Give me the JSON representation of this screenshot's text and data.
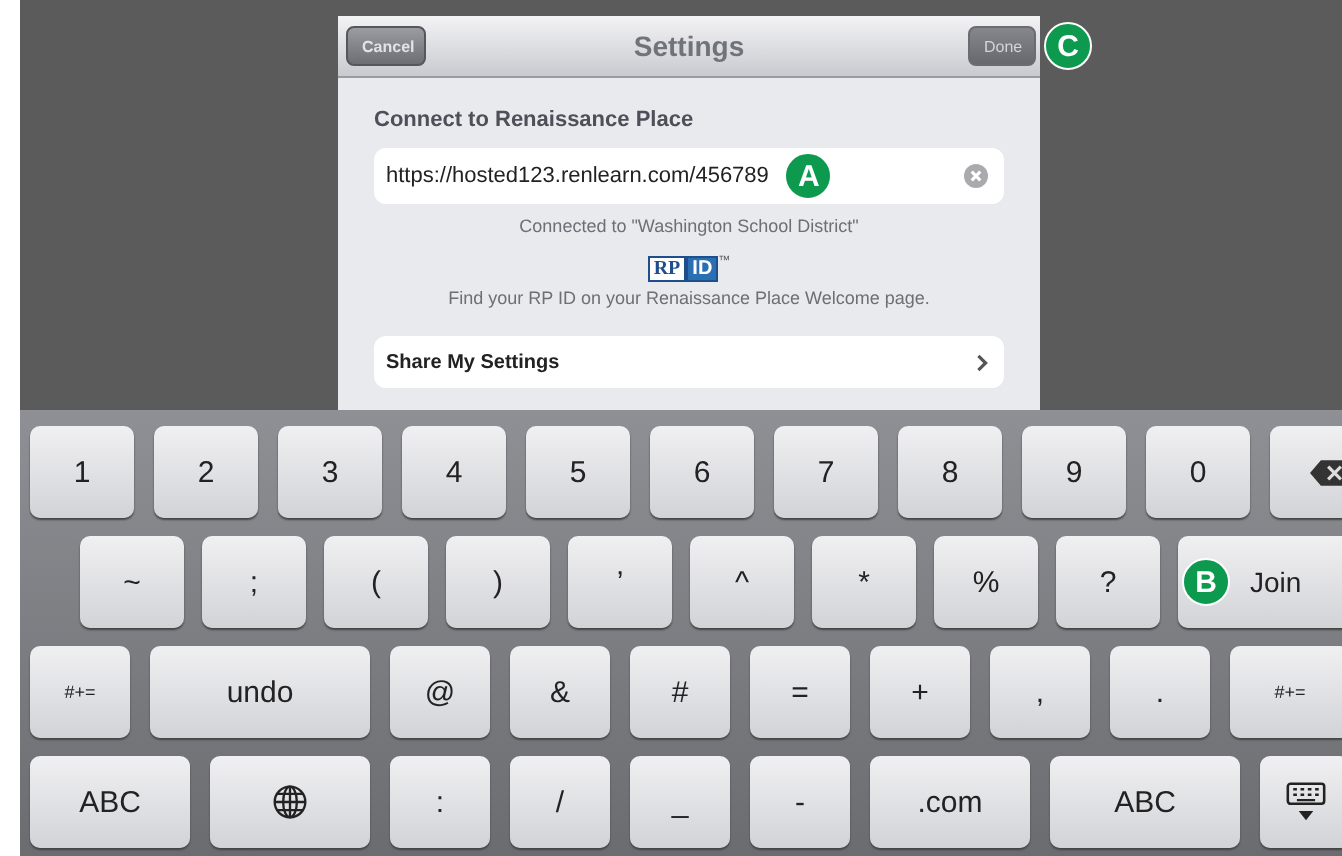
{
  "dialog": {
    "title": "Settings",
    "cancel": {
      "label": "Cancel",
      "disabled": false
    },
    "done": {
      "label": "Done",
      "disabled": true,
      "callout": "C"
    },
    "section_title": "Connect to Renaissance Place",
    "url_field": {
      "value": "https://hosted123.renlearn.com/456789",
      "callout": "A"
    },
    "status": "Connected to \"Washington School District\"",
    "logo": {
      "left": "RP",
      "right": "ID",
      "mark": "™"
    },
    "hint": "Find your RP ID on your Renaissance Place Welcome page.",
    "share_row": {
      "label": "Share My Settings"
    }
  },
  "keyboard": {
    "rows": [
      [
        {
          "kind": "char",
          "label": "1"
        },
        {
          "kind": "char",
          "label": "2"
        },
        {
          "kind": "char",
          "label": "3"
        },
        {
          "kind": "char",
          "label": "4"
        },
        {
          "kind": "char",
          "label": "5"
        },
        {
          "kind": "char",
          "label": "6"
        },
        {
          "kind": "char",
          "label": "7"
        },
        {
          "kind": "char",
          "label": "8"
        },
        {
          "kind": "char",
          "label": "9"
        },
        {
          "kind": "char",
          "label": "0"
        },
        {
          "kind": "delete"
        }
      ],
      [
        {
          "kind": "char",
          "label": "~"
        },
        {
          "kind": "char",
          "label": ";"
        },
        {
          "kind": "char",
          "label": "("
        },
        {
          "kind": "char",
          "label": ")"
        },
        {
          "kind": "char",
          "label": "’"
        },
        {
          "kind": "char",
          "label": "^"
        },
        {
          "kind": "char",
          "label": "*"
        },
        {
          "kind": "char",
          "label": "%"
        },
        {
          "kind": "char",
          "label": "?"
        },
        {
          "kind": "action",
          "label": "Join",
          "callout": "B"
        }
      ],
      [
        {
          "kind": "small",
          "label": "#+="
        },
        {
          "kind": "char",
          "label": "undo"
        },
        {
          "kind": "char",
          "label": "@"
        },
        {
          "kind": "char",
          "label": "&"
        },
        {
          "kind": "char",
          "label": "#"
        },
        {
          "kind": "char",
          "label": "="
        },
        {
          "kind": "char",
          "label": "+"
        },
        {
          "kind": "char",
          "label": ","
        },
        {
          "kind": "char",
          "label": "."
        },
        {
          "kind": "small",
          "label": "#+="
        }
      ],
      [
        {
          "kind": "char",
          "label": "ABC"
        },
        {
          "kind": "globe"
        },
        {
          "kind": "char",
          "label": ":"
        },
        {
          "kind": "char",
          "label": "/"
        },
        {
          "kind": "char",
          "label": "_"
        },
        {
          "kind": "char",
          "label": "-"
        },
        {
          "kind": "char",
          "label": ".com"
        },
        {
          "kind": "char",
          "label": "ABC"
        },
        {
          "kind": "hide"
        }
      ]
    ]
  }
}
